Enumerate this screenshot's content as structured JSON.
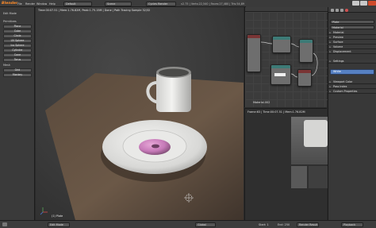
{
  "app": {
    "logo": "Blender",
    "menu": [
      "File",
      "Render",
      "Window",
      "Help"
    ],
    "layout": "Default",
    "scene": "Scene",
    "engine": "Cycles Render",
    "version": "v2.75 | Verts:22,540 | Faces:27,480 | Tris:54,892 | Objects:0/8 | Lamps:0/1 | Mem:"
  },
  "viewport": {
    "stats": "Time:00:07.51 | Mem:1.76.82M, Peak:1.75.15M | Done | Path Tracing Sample 32/32",
    "object_label": "(1) Plate",
    "mode": "Edit Mode",
    "shading": "Global"
  },
  "toolshelf": {
    "sections": [
      "Edit Mode",
      "Primitives",
      "Mesh"
    ],
    "buttons": [
      "Plane",
      "Cube",
      "Circle",
      "UV Sphere",
      "Ico Sphere",
      "Cylinder",
      "Cone",
      "Torus",
      "Grid",
      "Monkey"
    ]
  },
  "node_editor": {
    "header_items": [
      "View",
      "Select",
      "Add",
      "Node"
    ],
    "material_label": "Material.002"
  },
  "image_editor": {
    "stats": "Frame:63 | Time:00:07.51 | Mem:1.76.82M",
    "footer": [
      "Render Result",
      "View"
    ]
  },
  "properties": {
    "header": "Plate",
    "subheader": "Material",
    "rows": [
      "Material",
      "Preview",
      "Surface",
      "Volume",
      "Displacement",
      "Settings",
      "Viewport Color",
      "Pass Index",
      "Custom Properties"
    ],
    "selected_value": "White"
  },
  "timeline": {
    "items": [
      "View",
      "Marker",
      "Frame",
      "Playback"
    ],
    "start": "Start: 1",
    "end": "End: 250"
  },
  "colors": {
    "accent_blue": "#5680c2",
    "node_header_teal": "#3d7a76",
    "node_header_red": "#7a3535",
    "window_title_orange": "#d07a35"
  }
}
